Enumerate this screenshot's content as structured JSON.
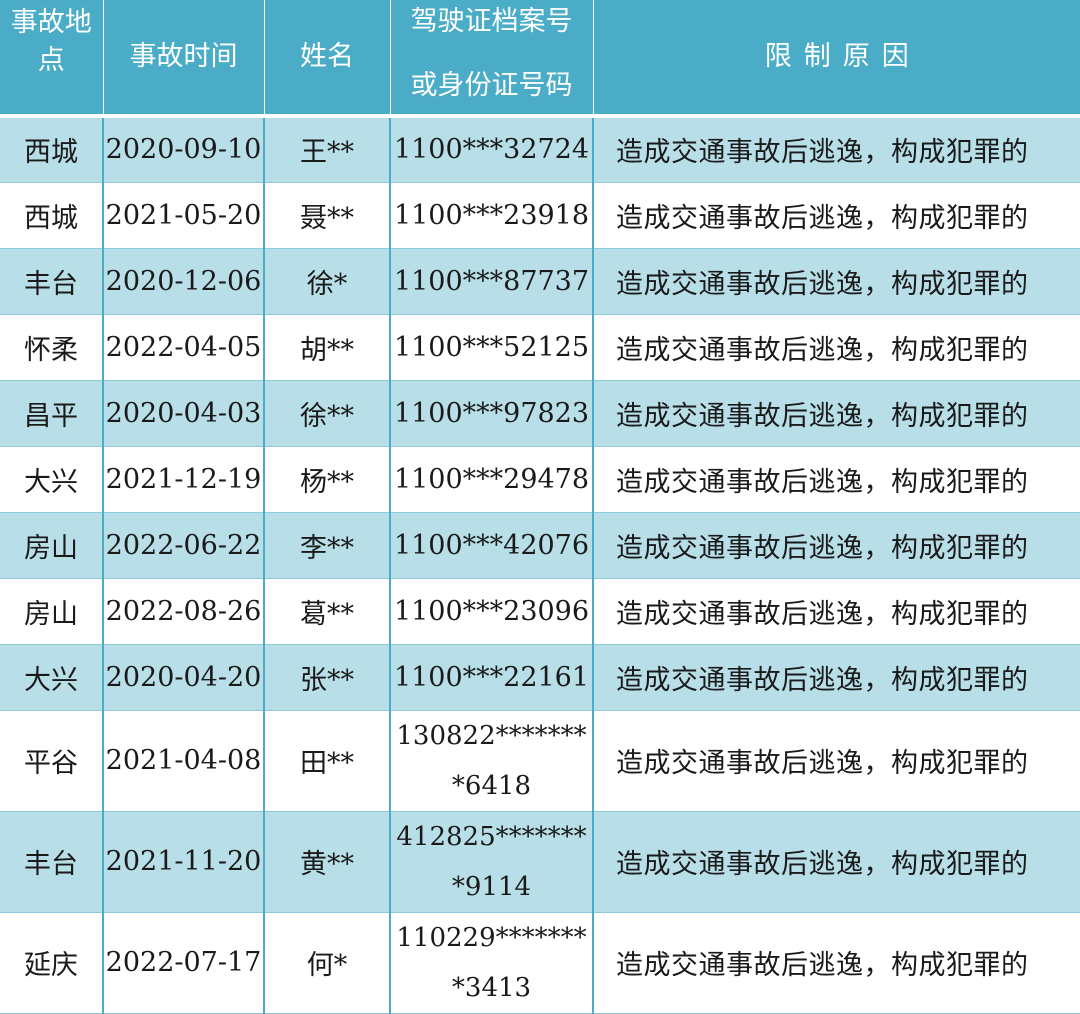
{
  "table": {
    "headers": {
      "location": [
        "事故地",
        "点"
      ],
      "time": "事故时间",
      "name": "姓名",
      "id": [
        "驾驶证档案号",
        "或身份证号码"
      ],
      "reason": "限制原因"
    },
    "rows": [
      {
        "location": "西城",
        "time": "2020-09-10",
        "name": "王**",
        "id": [
          "1100***32724"
        ],
        "reason": "造成交通事故后逃逸，构成犯罪的"
      },
      {
        "location": "西城",
        "time": "2021-05-20",
        "name": "聂**",
        "id": [
          "1100***23918"
        ],
        "reason": "造成交通事故后逃逸，构成犯罪的"
      },
      {
        "location": "丰台",
        "time": "2020-12-06",
        "name": "徐*",
        "id": [
          "1100***87737"
        ],
        "reason": "造成交通事故后逃逸，构成犯罪的"
      },
      {
        "location": "怀柔",
        "time": "2022-04-05",
        "name": "胡**",
        "id": [
          "1100***52125"
        ],
        "reason": "造成交通事故后逃逸，构成犯罪的"
      },
      {
        "location": "昌平",
        "time": "2020-04-03",
        "name": "徐**",
        "id": [
          "1100***97823"
        ],
        "reason": "造成交通事故后逃逸，构成犯罪的"
      },
      {
        "location": "大兴",
        "time": "2021-12-19",
        "name": "杨**",
        "id": [
          "1100***29478"
        ],
        "reason": "造成交通事故后逃逸，构成犯罪的"
      },
      {
        "location": "房山",
        "time": "2022-06-22",
        "name": "李**",
        "id": [
          "1100***42076"
        ],
        "reason": "造成交通事故后逃逸，构成犯罪的"
      },
      {
        "location": "房山",
        "time": "2022-08-26",
        "name": "葛**",
        "id": [
          "1100***23096"
        ],
        "reason": "造成交通事故后逃逸，构成犯罪的"
      },
      {
        "location": "大兴",
        "time": "2020-04-20",
        "name": "张**",
        "id": [
          "1100***22161"
        ],
        "reason": "造成交通事故后逃逸，构成犯罪的"
      },
      {
        "location": "平谷",
        "time": "2021-04-08",
        "name": "田**",
        "id": [
          "130822*******",
          "*6418"
        ],
        "reason": "造成交通事故后逃逸，构成犯罪的"
      },
      {
        "location": "丰台",
        "time": "2021-11-20",
        "name": "黄**",
        "id": [
          "412825*******",
          "*9114"
        ],
        "reason": "造成交通事故后逃逸，构成犯罪的"
      },
      {
        "location": "延庆",
        "time": "2022-07-17",
        "name": "何*",
        "id": [
          "110229*******",
          "*3413"
        ],
        "reason": "造成交通事故后逃逸，构成犯罪的"
      }
    ]
  }
}
